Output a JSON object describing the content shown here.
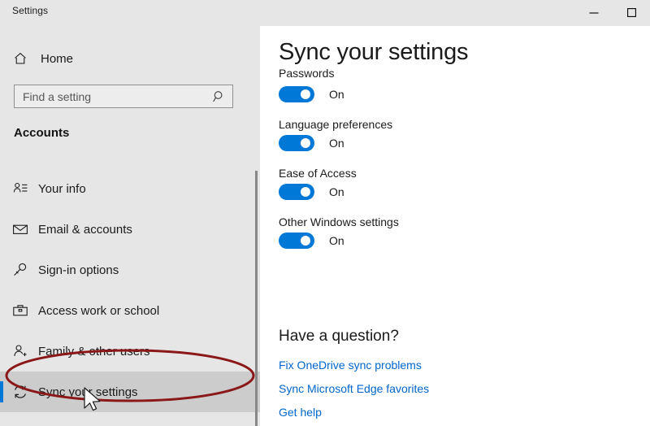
{
  "window": {
    "title": "Settings",
    "buttons": [
      {
        "name": "minimize",
        "glyph": "minimize-icon"
      },
      {
        "name": "maximize",
        "glyph": "maximize-icon"
      }
    ]
  },
  "sidebar": {
    "home_label": "Home",
    "search": {
      "placeholder": "Find a setting",
      "value": ""
    },
    "section_title": "Accounts",
    "items": [
      {
        "label": "Your info",
        "icon": "user-info-icon",
        "selected": false
      },
      {
        "label": "Email & accounts",
        "icon": "envelope-icon",
        "selected": false
      },
      {
        "label": "Sign-in options",
        "icon": "key-icon",
        "selected": false
      },
      {
        "label": "Access work or school",
        "icon": "briefcase-icon",
        "selected": false
      },
      {
        "label": "Family & other users",
        "icon": "user-add-icon",
        "selected": false
      },
      {
        "label": "Sync your settings",
        "icon": "sync-icon",
        "selected": true
      }
    ]
  },
  "main": {
    "page_title": "Sync your settings",
    "clipped_label": "Passwords",
    "toggles": [
      {
        "label": "",
        "state": "On",
        "on": true
      },
      {
        "label": "Language preferences",
        "state": "On",
        "on": true
      },
      {
        "label": "Ease of Access",
        "state": "On",
        "on": true
      },
      {
        "label": "Other Windows settings",
        "state": "On",
        "on": true
      }
    ],
    "help_heading": "Have a question?",
    "links": [
      "Fix OneDrive sync problems",
      "Sync Microsoft Edge favorites",
      "Get help"
    ]
  },
  "annotation": {
    "ellipse_color": "#8b1818",
    "cursor": "arrow-cursor"
  },
  "colors": {
    "accent": "#0078d7",
    "sidebar_bg": "#e6e6e6",
    "selected_bg": "#cccccc",
    "link": "#0066cc"
  }
}
